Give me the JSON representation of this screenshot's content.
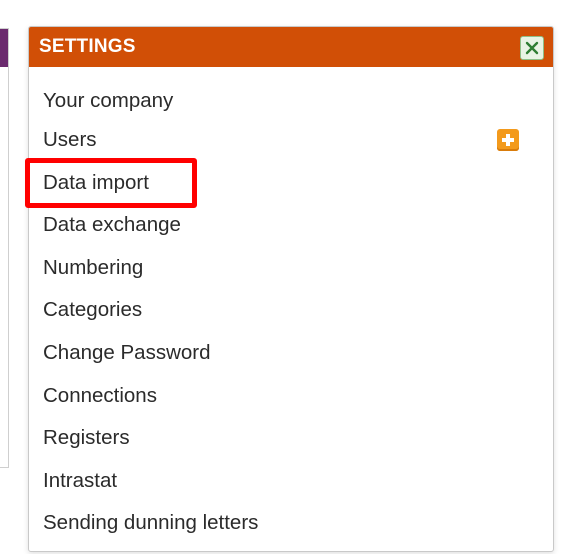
{
  "settings": {
    "title": "SETTINGS",
    "close_icon": "close-icon",
    "items": [
      {
        "label": "Your company"
      },
      {
        "label": "Users",
        "action_icon": "plus-icon"
      },
      {
        "label": "Data import",
        "highlighted": true
      },
      {
        "label": "Data exchange"
      },
      {
        "label": "Numbering"
      },
      {
        "label": "Categories"
      },
      {
        "label": "Change Password"
      },
      {
        "label": "Connections"
      },
      {
        "label": "Registers"
      },
      {
        "label": "Intrastat"
      },
      {
        "label": "Sending dunning letters"
      }
    ]
  },
  "colors": {
    "header_bg": "#d14f06",
    "header_text": "#ffffff",
    "highlight": "#ff0000",
    "add_button": "#f39a1c",
    "left_panel_header": "#6b2a6e"
  }
}
